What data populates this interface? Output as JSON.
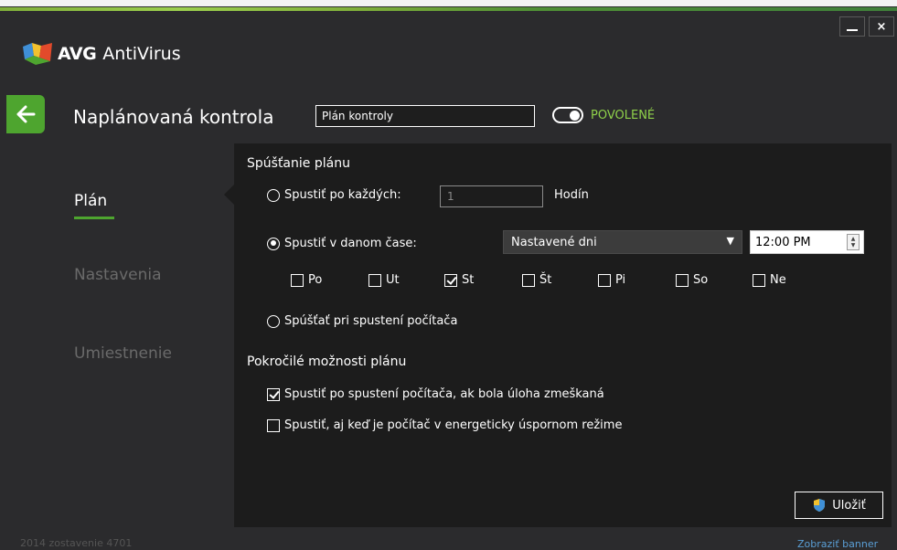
{
  "window": {
    "app_brand": "AVG",
    "app_product": "AntiVirus",
    "minimize_symbol": "",
    "close_symbol": "×"
  },
  "header": {
    "title": "Naplánovaná kontrola",
    "name_value": "Plán kontroly",
    "toggle_label": "POVOLENÉ",
    "toggle_on": true
  },
  "nav": {
    "items": [
      {
        "label": "Plán",
        "active": true
      },
      {
        "label": "Nastavenia",
        "active": false
      },
      {
        "label": "Umiestnenie",
        "active": false
      }
    ]
  },
  "schedule": {
    "section_title": "Spúšťanie plánu",
    "every_label": "Spustiť po každých:",
    "every_value": "1",
    "every_unit": "Hodín",
    "at_time_label": "Spustiť v danom čase:",
    "days_dropdown": "Nastavené dni",
    "dropdown_arrow": "▼",
    "time_value": "12:00 PM",
    "days": [
      {
        "label": "Po",
        "checked": false
      },
      {
        "label": "Ut",
        "checked": false
      },
      {
        "label": "St",
        "checked": true
      },
      {
        "label": "Št",
        "checked": false
      },
      {
        "label": "Pi",
        "checked": false
      },
      {
        "label": "So",
        "checked": false
      },
      {
        "label": "Ne",
        "checked": false
      }
    ],
    "on_startup_label": "Spúšťať pri spustení počítača",
    "selected_mode": "at_time"
  },
  "advanced": {
    "section_title": "Pokročilé možnosti plánu",
    "options": [
      {
        "label": "Spustiť po spustení počítača, ak bola úloha zmeškaná",
        "checked": true
      },
      {
        "label": "Spustiť, aj keď je počítač v energeticky úspornom režime",
        "checked": false
      }
    ]
  },
  "actions": {
    "save_label": "Uložiť"
  },
  "footer": {
    "build_text": "2014 zostavenie 4701",
    "banner_link": "Zobraziť banner"
  },
  "colors": {
    "accent_green": "#4ea52f",
    "toggle_green": "#8fd14a",
    "panel_bg": "#1c1c1c",
    "window_bg": "#2b2b2d",
    "link_blue": "#5a9fd6"
  }
}
